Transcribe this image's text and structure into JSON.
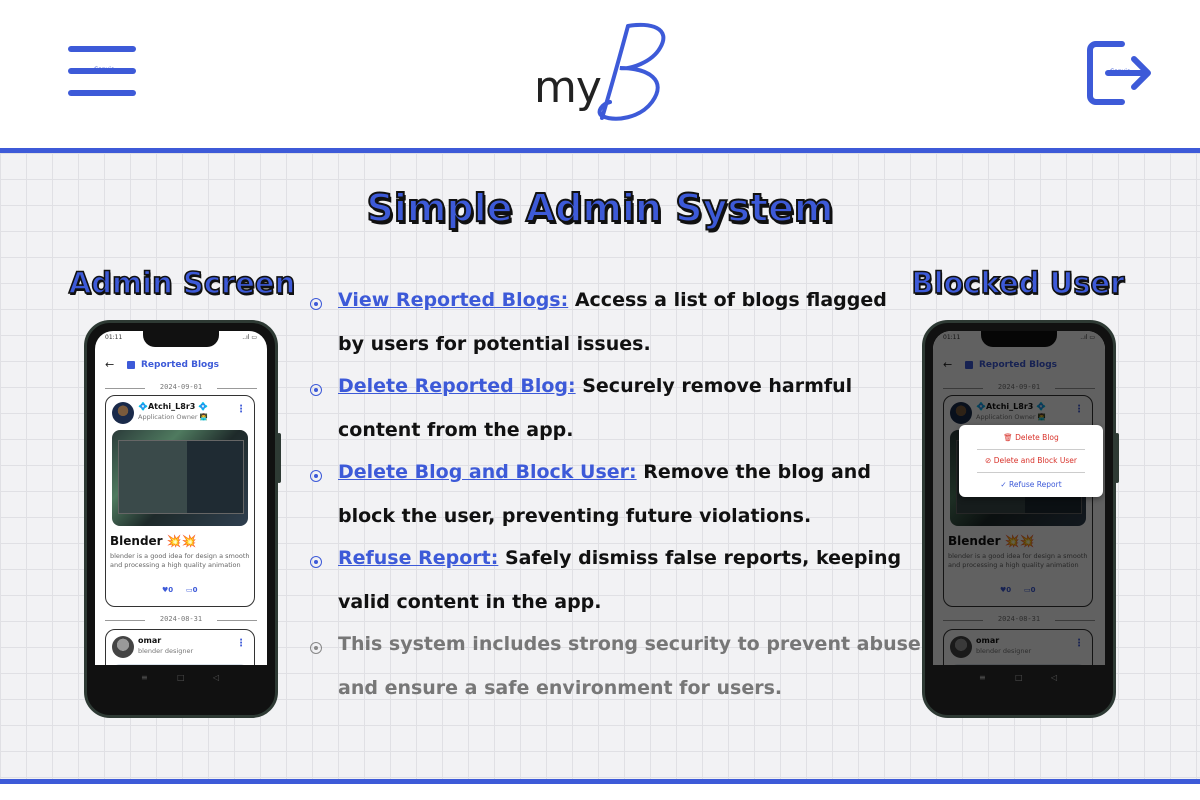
{
  "header": {
    "menu_tiny": "Canvio",
    "logo_text": "my",
    "logout_tiny": "Canvio"
  },
  "title": "Simple Admin System",
  "left_panel": {
    "title": "Admin Screen",
    "phone": {
      "status_time": "01:11",
      "status_right": "..ıl ▭",
      "app_title": "Reported Blogs",
      "date1": "2024-09-01",
      "card1": {
        "user": "💠Atchi_L8r3 💠",
        "role": "Application Owner 👨‍💻",
        "blog_title": "Blender 💥💥",
        "blog_desc": "blender is a good idea for design a smooth and processing a high quality animation",
        "likes": "♥0",
        "comments": "▭0"
      },
      "date2": "2024-08-31",
      "card2": {
        "user": "omar",
        "role": "blender designer"
      }
    }
  },
  "right_panel": {
    "title": "Blocked User",
    "menu": {
      "delete_blog": "Delete Blog",
      "delete_block": "Delete and Block User",
      "refuse": "Refuse Report"
    }
  },
  "features": [
    {
      "link": "View Reported Blogs:",
      "text1": " Access a list of blogs flagged",
      "text2": "by users for potential issues."
    },
    {
      "link": "Delete Reported Blog:",
      "text1": " Securely remove harmful",
      "text2": "content from the app."
    },
    {
      "link": "Delete Blog and Block User:",
      "text1": " Remove the blog and",
      "text2": "block the user, preventing future violations."
    },
    {
      "link": "Refuse Report:",
      "text1": " Safely dismiss false reports, keeping",
      "text2": "valid content in the app."
    }
  ],
  "note": {
    "line1": "This system includes strong security to prevent abuse",
    "line2": "and ensure a safe environment for users."
  },
  "colors": {
    "accent": "#3d5ad8",
    "danger": "#d8322a",
    "text": "#111111",
    "muted": "#777777"
  }
}
